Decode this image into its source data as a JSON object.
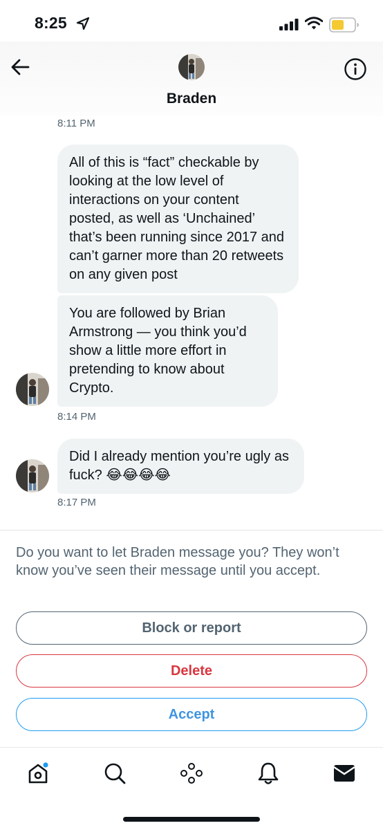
{
  "status_bar": {
    "time": "8:25",
    "battery_color": "#f5c932"
  },
  "header": {
    "contact_name": "Braden"
  },
  "messages": {
    "ts_first": "8:11 PM",
    "group1": [
      "All of this is “fact” checkable by looking at the low level of interactions on your content posted, as well as ‘Unchained’ that’s been running since 2017 and can’t garner more than 20 retweets on any given post",
      "You are followed by Brian Armstrong — you think you’d show a little more effort in pretending to know about Crypto."
    ],
    "ts_group1": "8:14 PM",
    "group2": [
      "Did I already mention you’re ugly as fuck? 😂😂😂😂"
    ],
    "ts_group2": "8:17 PM"
  },
  "request": {
    "prompt": "Do you want to let Braden message you? They won’t know you’ve seen their message until you accept.",
    "block_label": "Block or report",
    "delete_label": "Delete",
    "accept_label": "Accept"
  },
  "tab_bar": {
    "items": [
      "home-icon",
      "search-icon",
      "spaces-icon",
      "notifications-icon",
      "messages-icon"
    ],
    "active": "messages-icon",
    "badge_color": "#1d9bf0"
  },
  "colors": {
    "accent": "#1d9bf0",
    "danger": "#d9363e",
    "secondary_text": "#536471",
    "bubble": "#eff3f4"
  }
}
